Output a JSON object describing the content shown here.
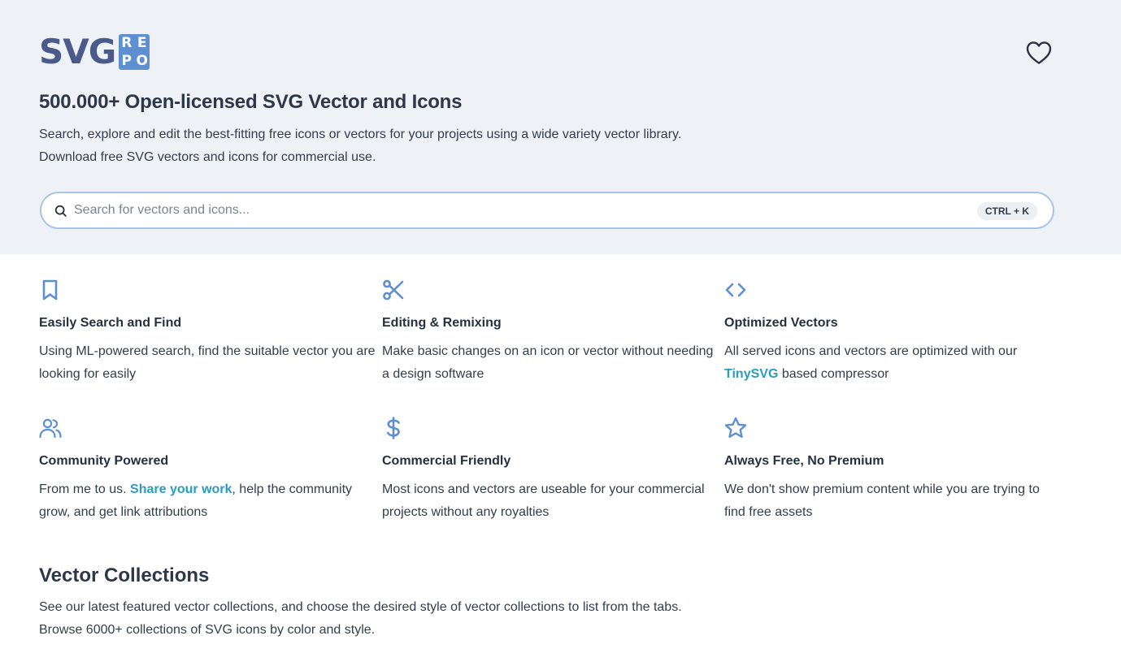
{
  "logo": {
    "word": "SVG",
    "box_letters": [
      "R",
      "E",
      "P",
      "O"
    ]
  },
  "header": {
    "favorite_icon": "heart-outline-icon",
    "title": "500.000+ Open-licensed SVG Vector and Icons",
    "desc_line1": "Search, explore and edit the best-fitting free icons or vectors for your projects using a wide variety vector library.",
    "desc_line2": "Download free SVG vectors and icons for commercial use."
  },
  "search": {
    "icon": "search-icon",
    "placeholder": "Search for vectors and icons...",
    "value": "",
    "shortcut": "CTRL + K"
  },
  "features": [
    {
      "icon": "bookmark-icon",
      "title": "Easily Search and Find",
      "desc": "Using ML-powered search, find the suitable vector you are looking for easily"
    },
    {
      "icon": "scissors-icon",
      "title": "Editing & Remixing",
      "desc": "Make basic changes on an icon or vector without needing a design software"
    },
    {
      "icon": "code-icon",
      "title": "Optimized Vectors",
      "desc_before": "All served icons and vectors are optimized with our ",
      "link": "TinySVG",
      "desc_after": " based compressor"
    },
    {
      "icon": "users-icon",
      "title": "Community Powered",
      "desc_before": "From me to us. ",
      "link": "Share your work",
      "desc_after": ", help the community grow, and get link attributions"
    },
    {
      "icon": "dollar-icon",
      "title": "Commercial Friendly",
      "desc": "Most icons and vectors are useable for your commercial projects without any royalties"
    },
    {
      "icon": "star-icon",
      "title": "Always Free, No Premium",
      "desc": "We don't show premium content while you are trying to find free assets"
    }
  ],
  "collections": {
    "title": "Vector Collections",
    "desc_line1": "See our latest featured vector collections, and choose the desired style of vector collections to list from the tabs.",
    "desc_line2": "Browse 6000+ collections of SVG icons by color and style."
  },
  "colors": {
    "accent": "#5e8fd0",
    "link": "#2a9cc4",
    "hero_bg": "#eef2f7",
    "logo_text": "#4a5a8a"
  }
}
